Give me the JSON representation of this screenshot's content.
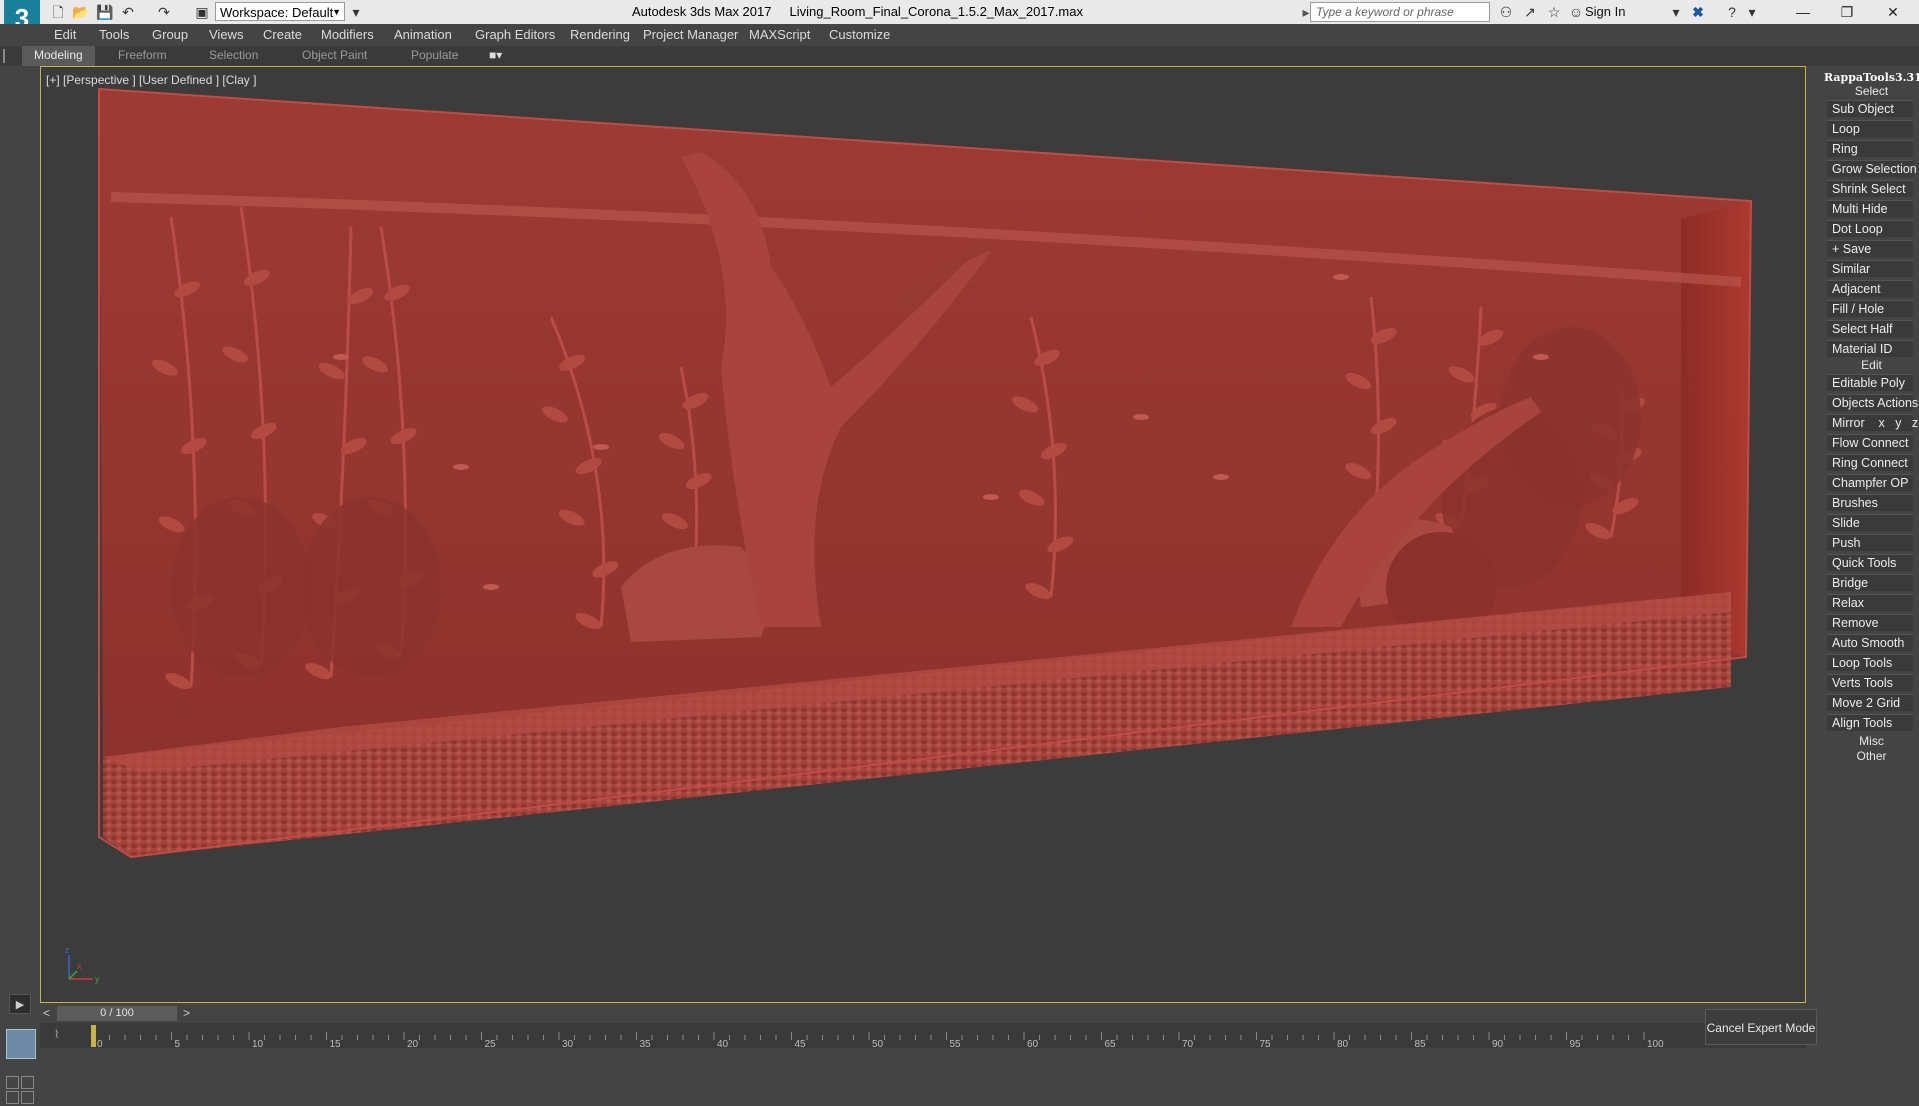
{
  "titlebar": {
    "logo": "3",
    "workspace": "Workspace: Default",
    "window_title": "Autodesk 3ds Max 2017     Living_Room_Final_Corona_1.5.2_Max_2017.max",
    "search_placeholder": "Type a keyword or phrase",
    "signin": "Sign In"
  },
  "menu": [
    "Edit",
    "Tools",
    "Group",
    "Views",
    "Create",
    "Modifiers",
    "Animation",
    "Graph Editors",
    "Rendering",
    "Project Manager",
    "MAXScript",
    "Customize"
  ],
  "ribbon": [
    "Modeling",
    "Freeform",
    "Selection",
    "Object Paint",
    "Populate"
  ],
  "viewport": {
    "label": "[+] [Perspective ] [User Defined ] [Clay ]",
    "axis_x": "x",
    "axis_y": "y",
    "axis_z": "z",
    "model_color": "#a23a35"
  },
  "rappa": {
    "title": "RappaTools3.31",
    "sections": {
      "select": "Select",
      "edit": "Edit",
      "misc": "Misc",
      "other": "Other"
    },
    "select_items": [
      "Sub Object",
      "Loop",
      "Ring",
      "Grow Selection",
      "Shrink Select",
      "Multi Hide",
      "Dot Loop",
      "+ Save",
      "Similar",
      "Adjacent",
      "Fill / Hole",
      "Select Half",
      "Material ID"
    ],
    "edit_items": [
      "Editable Poly",
      "Objects Actions",
      "Mirror    x   y   z",
      "Flow Connect",
      "Ring Connect",
      "Champfer OP",
      "Brushes",
      "Slide",
      "Push",
      "Quick Tools",
      "Bridge",
      "Relax",
      "Remove",
      "Auto Smooth",
      "Loop Tools",
      "Verts Tools",
      "Move 2 Grid",
      "Align Tools"
    ]
  },
  "timeslider": {
    "left": "<",
    "value": "0 / 100",
    "right": ">"
  },
  "trackbar": {
    "ticks": [
      "0",
      "5",
      "10",
      "15",
      "20",
      "25",
      "30",
      "35",
      "40",
      "45",
      "50",
      "55",
      "60",
      "65",
      "70",
      "75",
      "80",
      "85",
      "90",
      "95",
      "100"
    ],
    "cancel_expert": "Cancel Expert Mode"
  }
}
